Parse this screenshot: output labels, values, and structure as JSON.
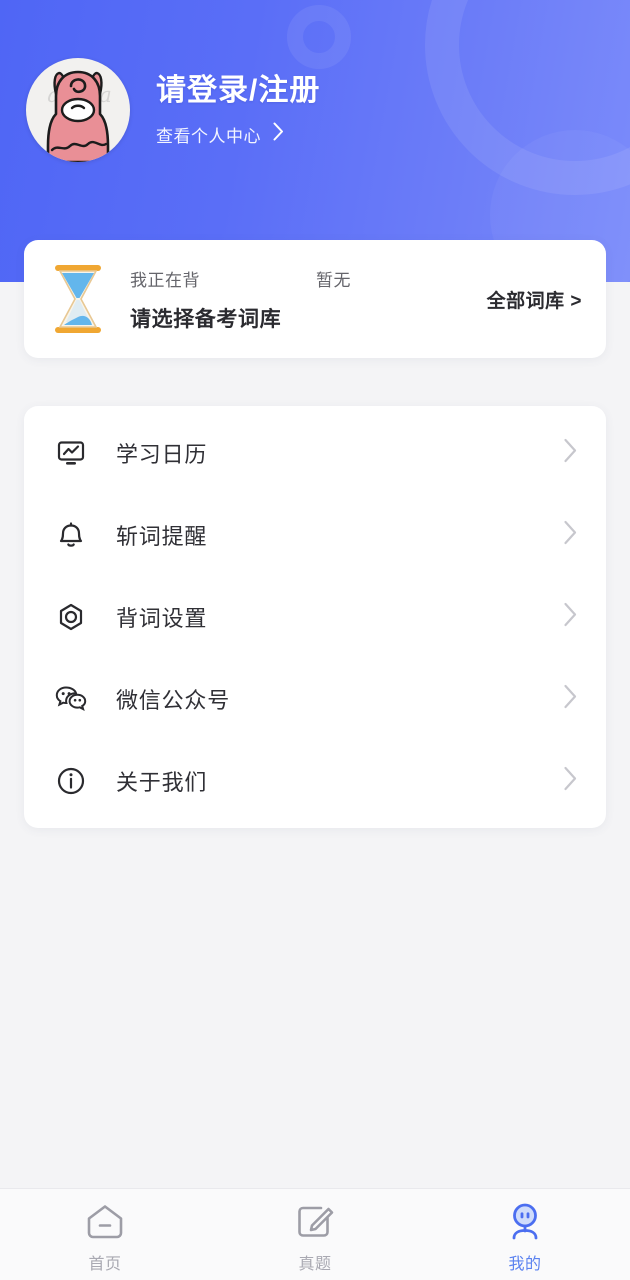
{
  "theme": {
    "gradient_start": "#4f66f5",
    "gradient_end": "#7b8bfa",
    "page_bg": "#f4f4f6",
    "card_bg": "#ffffff",
    "accent": "#5b82f0",
    "text_primary": "#303036",
    "text_secondary": "#65656b",
    "chevron": "#c7c7cd"
  },
  "header": {
    "avatar_icon": "llama-avatar",
    "login_title": "请登录/注册",
    "profile_link_label": "查看个人中心",
    "profile_link_icon": "chevron-right-icon",
    "deco_ring_big_icon": "decorative-ring-large",
    "deco_ring_small_icon": "decorative-ring-small",
    "deco_disc_icon": "decorative-circle"
  },
  "wordbank": {
    "icon": "hourglass-icon",
    "label": "我正在背",
    "value": "暂无",
    "main_text": "请选择备考词库",
    "all_banks_label": "全部词库 >"
  },
  "menu": {
    "items": [
      {
        "id": "study-calendar",
        "label": "学习日历",
        "icon": "chart-monitor-icon",
        "chevron": "chevron-right-icon"
      },
      {
        "id": "word-reminder",
        "label": "斩词提醒",
        "icon": "bell-icon",
        "chevron": "chevron-right-icon"
      },
      {
        "id": "memorize-settings",
        "label": "背词设置",
        "icon": "hex-gear-icon",
        "chevron": "chevron-right-icon"
      },
      {
        "id": "wechat-official",
        "label": "微信公众号",
        "icon": "wechat-icon",
        "chevron": "chevron-right-icon"
      },
      {
        "id": "about-us",
        "label": "关于我们",
        "icon": "info-circle-icon",
        "chevron": "chevron-right-icon"
      }
    ]
  },
  "tabbar": {
    "tabs": [
      {
        "id": "home",
        "label": "首页",
        "icon": "home-icon",
        "active": false
      },
      {
        "id": "exams",
        "label": "真题",
        "icon": "edit-square-icon",
        "active": false
      },
      {
        "id": "mine",
        "label": "我的",
        "icon": "person-avatar-icon",
        "active": true
      }
    ]
  }
}
